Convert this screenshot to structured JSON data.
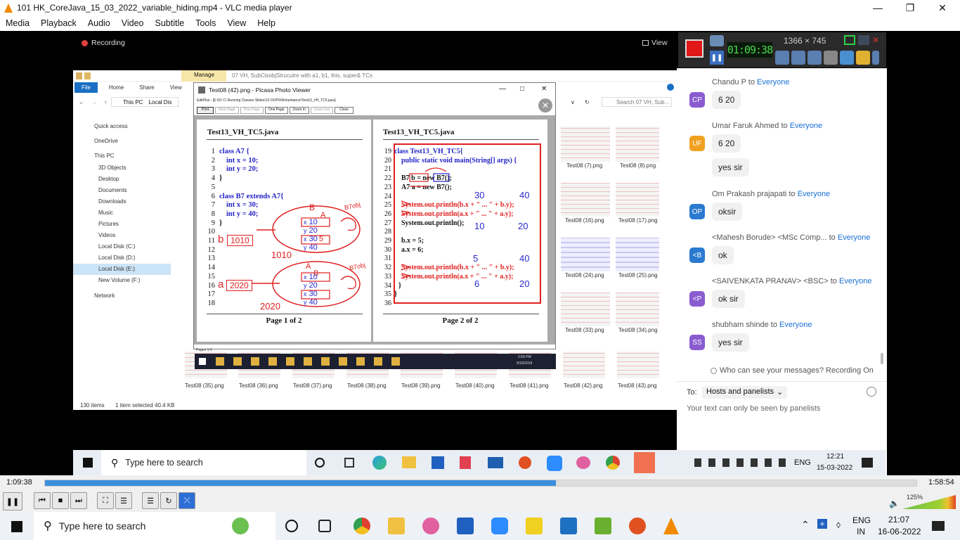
{
  "window": {
    "title": "101 HK_CoreJava_15_03_2022_variable_hiding.mp4 - VLC media player"
  },
  "menu": [
    "Media",
    "Playback",
    "Audio",
    "Video",
    "Subtitle",
    "Tools",
    "View",
    "Help"
  ],
  "video": {
    "recording_label": "Recording",
    "view_label": "View",
    "tool": {
      "timer": "01:09:38",
      "resolution": "1366 × 745"
    },
    "explorer": {
      "ribbon_tab": "Manage",
      "path_title": "07 VH, SubClsobjStrucutre with a1, b1, this, super& TCs",
      "tabs": [
        "File",
        "Home",
        "Share",
        "View"
      ],
      "breadcrumb": [
        "This PC",
        "Local Dis"
      ],
      "search_placeholder": "Search 07 VH, Sub...",
      "nav": [
        "Quick access",
        "OneDrive",
        "This PC",
        "3D Objects",
        "Desktop",
        "Documents",
        "Downloads",
        "Music",
        "Pictures",
        "Videos",
        "Local Disk (C:)",
        "Local Disk (D:)",
        "Local Disk (E:)",
        "New Volume (F:)",
        "Network"
      ],
      "thumbs_right": [
        "Test08 (7).png",
        "Test08 (8).png",
        "Test08 (16).png",
        "Test08 (17).png",
        "Test08 (24).png",
        "Test08 (25).png",
        "Test08 (33).png",
        "Test08 (34).png"
      ],
      "thumbs_bottom": [
        "Test08 (35).png",
        "Test08 (36).png",
        "Test08 (37).png",
        "Test08 (38).png",
        "Test08 (39).png",
        "Test08 (40).png",
        "Test08 (41).png",
        "Test08 (42).png",
        "Test08 (43).png"
      ],
      "status_items": "130 items",
      "status_selected": "1 item selected  40.4 KB"
    },
    "picasa": {
      "title": "Test08 (42).png - Picasa Photo Viewer",
      "editplus_path": "EditPlus - [E:\\01 C\\ Running Classes Slides\\13 OOP\\04Inheritance\\Test13_VH_TC5.java]",
      "toolbar": [
        "Print",
        "Next Page",
        "Prev Page",
        "One Page",
        "Zoom In",
        "Zoom Out",
        "Close"
      ],
      "page1": {
        "file": "Test13_VH_TC5.java",
        "lines": [
          [
            "1",
            "class A7 {"
          ],
          [
            "2",
            "int x = 10;"
          ],
          [
            "3",
            "int y = 20;"
          ],
          [
            "4",
            "}"
          ],
          [
            "5",
            ""
          ],
          [
            "6",
            "class B7 extends A7{"
          ],
          [
            "7",
            "int x = 30;"
          ],
          [
            "8",
            "int y = 40;"
          ],
          [
            "9",
            "}"
          ],
          [
            "10",
            ""
          ],
          [
            "11",
            ""
          ],
          [
            "12",
            ""
          ],
          [
            "13",
            ""
          ],
          [
            "14",
            ""
          ],
          [
            "15",
            ""
          ],
          [
            "16",
            ""
          ],
          [
            "17",
            ""
          ],
          [
            "18",
            ""
          ]
        ],
        "footer": "Page 1 of 2",
        "annotations": {
          "b_label": "b",
          "b_val": "1010",
          "b_val2": "1010",
          "a_label": "a",
          "a_val": "2020",
          "a_val2": "2020",
          "B": "B",
          "A": "A",
          "B7_1": "B7obj",
          "B7_2": "B7obj",
          "A2": "A",
          "B2": "B",
          "box1": [
            "x",
            "10",
            "y",
            "20",
            "x",
            "30",
            "5",
            "y",
            "40"
          ],
          "box2": [
            "x",
            "10",
            "y",
            "20",
            "x",
            "30",
            "y",
            "40"
          ]
        }
      },
      "page2": {
        "file": "Test13_VH_TC5.java",
        "lines": [
          [
            "19",
            "class Test13_VH_TC5{"
          ],
          [
            "20",
            "public static void main(String[] args) {"
          ],
          [
            "21",
            ""
          ],
          [
            "22",
            "B7 b = new B7();"
          ],
          [
            "23",
            "A7 a = new B7();"
          ],
          [
            "24",
            ""
          ],
          [
            "25",
            "System.out.println(b.x + \" ... \" + b.y);"
          ],
          [
            "26",
            "System.out.println(a.x + \" ... \" + a.y);"
          ],
          [
            "27",
            "System.out.println();"
          ],
          [
            "28",
            ""
          ],
          [
            "29",
            "b.x = 5;"
          ],
          [
            "30",
            "a.x = 6;"
          ],
          [
            "31",
            ""
          ],
          [
            "32",
            "System.out.println(b.x + \" ... \" + b.y);"
          ],
          [
            "33",
            "System.out.println(a.x + \" ... \" + a.y);"
          ],
          [
            "34",
            "}"
          ],
          [
            "35",
            "}"
          ],
          [
            "36",
            ""
          ]
        ],
        "footer": "Page 2 of 2",
        "outputs": [
          "30",
          "40",
          "10",
          "20",
          "5",
          "40",
          "6",
          "20"
        ]
      },
      "status": "Pages 1-2",
      "clock_time": "2:56 PM",
      "clock_date": "9/18/2018"
    },
    "chat": {
      "messages": [
        {
          "from": "Chandu P",
          "to": "Everyone",
          "initials": "CP",
          "color": "#8a5cd0",
          "text": [
            "6 20"
          ]
        },
        {
          "from": "Umar Faruk Ahmed",
          "to": "Everyone",
          "initials": "UF",
          "color": "#f0a020",
          "text": [
            "6 20",
            "yes sir"
          ]
        },
        {
          "from": "Om Prakash prajapati",
          "to": "Everyone",
          "initials": "OP",
          "color": "#2a7ad0",
          "text": [
            "oksir"
          ]
        },
        {
          "from": "<Mahesh Borude> <MSc Comp...",
          "to": "Everyone",
          "initials": "<B",
          "color": "#2a7ad0",
          "text": [
            "ok"
          ]
        },
        {
          "from": "<SAIVENKATA PRANAV> <BSC>",
          "to": "Everyone",
          "initials": "<P",
          "color": "#8a5cd0",
          "text": [
            "ok sir"
          ]
        },
        {
          "from": "shubham shinde",
          "to": "Everyone",
          "initials": "SS",
          "color": "#8a5cd0",
          "text": [
            "yes sir"
          ]
        }
      ],
      "to_word": "to",
      "privacy": "Who can see your messages? Recording On",
      "to_label": "To:",
      "recipient": "Hosts and panelists",
      "input_placeholder": "Your text can only be seen by panelists"
    },
    "inner_taskbar": {
      "search": "Type here to search",
      "lang": "ENG",
      "time": "12:21",
      "date": "15-03-2022"
    }
  },
  "player": {
    "elapsed": "1:09:38",
    "total": "1:58:54",
    "progress": 0.586,
    "volume": "125%"
  },
  "taskbar": {
    "search": "Type here to search",
    "lang": "ENG",
    "lang2": "IN",
    "time": "21:07",
    "date": "16-06-2022"
  }
}
